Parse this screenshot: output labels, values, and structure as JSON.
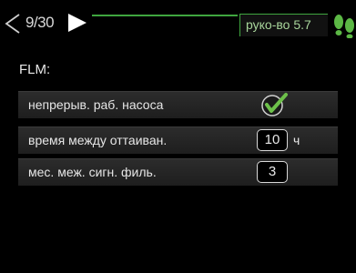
{
  "header": {
    "page_counter": "9/30",
    "guide_label": "руко-во 5.7",
    "accent_color": "#3fa53f"
  },
  "section": {
    "title": "FLM:"
  },
  "rows": [
    {
      "label": "непрерыв. раб. насоса",
      "control": "checkbox",
      "checked": true
    },
    {
      "label": "время между оттаиван.",
      "control": "value",
      "value": "10",
      "unit": "ч"
    },
    {
      "label": "мес. меж. сигн. филь.",
      "control": "value",
      "value": "3"
    }
  ]
}
